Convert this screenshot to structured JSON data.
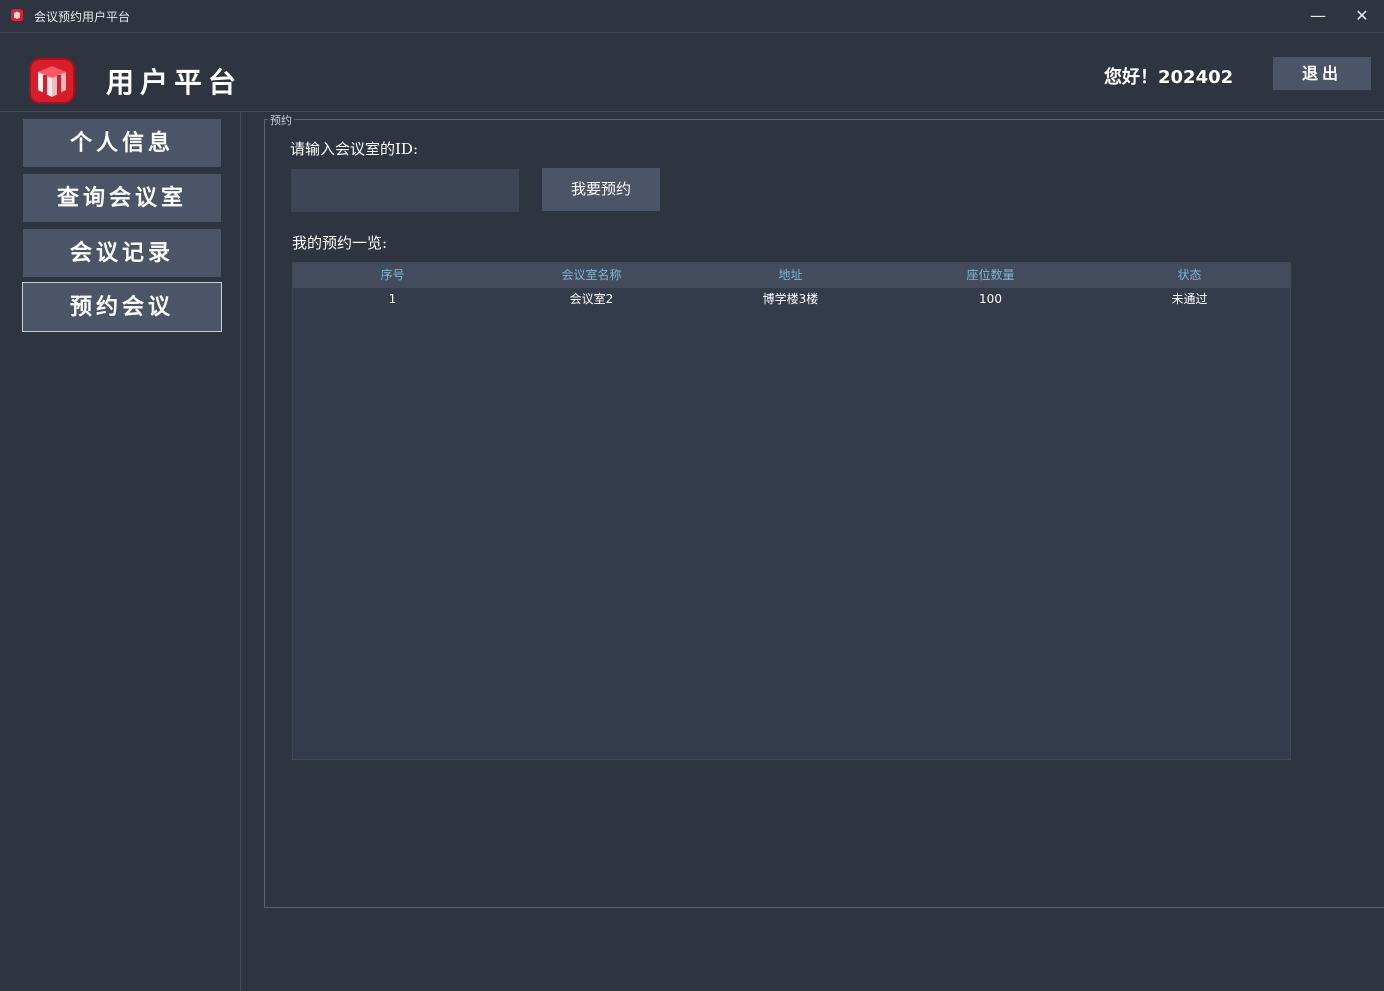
{
  "window": {
    "title": "会议预约用户平台",
    "minimize_glyph": "—",
    "close_glyph": "✕"
  },
  "header": {
    "title": "用户平台",
    "greeting": "您好！202402",
    "logout_label": "退出",
    "logo_icon": "red-cube-logo-icon"
  },
  "sidebar": {
    "items": [
      {
        "label": "个人信息",
        "active": false
      },
      {
        "label": "查询会议室",
        "active": false
      },
      {
        "label": "会议记录",
        "active": false
      },
      {
        "label": "预约会议",
        "active": true
      }
    ]
  },
  "main": {
    "group_title": "预约",
    "id_label": "请输入会议室的ID:",
    "id_input_value": "",
    "reserve_button": "我要预约",
    "list_label": "我的预约一览:",
    "table": {
      "columns": [
        "序号",
        "会议室名称",
        "地址",
        "座位数量",
        "状态"
      ],
      "rows": [
        [
          "1",
          "会议室2",
          "博学楼3楼",
          "100",
          "未通过"
        ]
      ]
    }
  },
  "colors": {
    "background": "#2e3440",
    "button": "#4c5568",
    "header_text_accent": "#78b8d8",
    "logo_red": "#e0202e"
  }
}
